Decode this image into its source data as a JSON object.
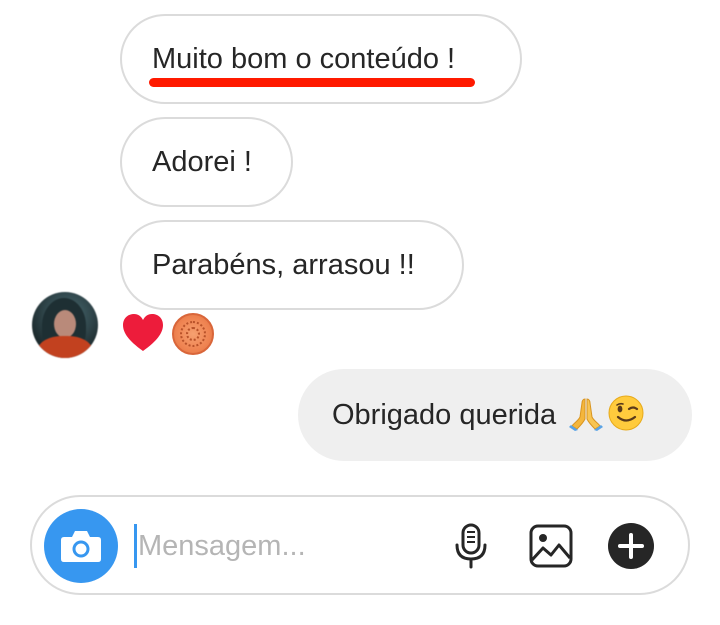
{
  "messages_in": [
    {
      "text": "Muito bom o conteúdo !"
    },
    {
      "text": "Adorei !"
    },
    {
      "text": "Parabéns, arrasou !!"
    }
  ],
  "reactions": {
    "heart_icon": "heart-icon",
    "sticker_icon": "sticker-icon"
  },
  "message_out": {
    "text": "Obrigado querida ",
    "emojis": [
      "folded-hands-emoji",
      "winking-face-emoji"
    ]
  },
  "composer": {
    "placeholder": "Mensagem..."
  },
  "colors": {
    "accent": "#3797f0",
    "highlight_underline": "#ff1a00",
    "heart": "#ed1c3b",
    "outgoing_bubble": "#efefef"
  }
}
